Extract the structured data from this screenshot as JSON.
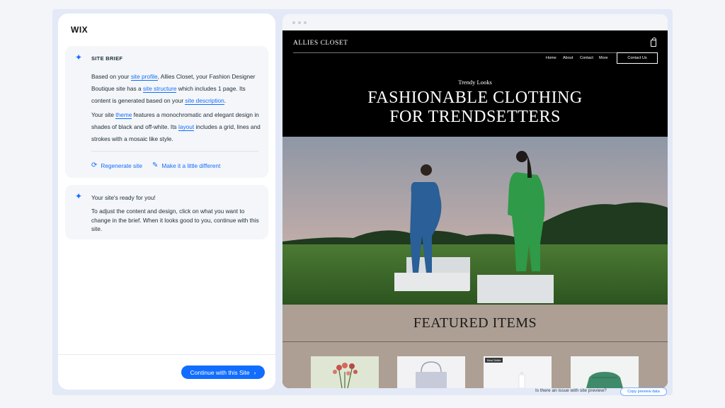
{
  "app": {
    "logo": "WIX"
  },
  "brief": {
    "title": "SITE BRIEF",
    "p1": {
      "t1": "Based on your ",
      "l1": "site profile",
      "t2": ", Allies Closet, your Fashion Designer Boutique site has a ",
      "l2": "site structure",
      "t3": " which includes 1 page. Its content is generated based on your ",
      "l3": "site description",
      "t4": "."
    },
    "p2": {
      "t1": "Your site ",
      "l1": "theme",
      "t2": " features a monochromatic and elegant design in shades of black and off-white. Its ",
      "l2": "layout",
      "t3": " includes a grid, lines and strokes with a mosaic like style."
    },
    "actions": {
      "regenerate": "Regenerate site",
      "different": "Make it a little different"
    }
  },
  "ready": {
    "title": "Your site's ready for you!",
    "text": "To adjust the content and design, click on what you want to change in the brief. When it looks good to you, continue with this site."
  },
  "footer": {
    "continue_label": "Continue with this Site",
    "continue_arrow": "›"
  },
  "preview": {
    "site_name": "ALLIES CLOSET",
    "nav": [
      "Home",
      "About",
      "Contact",
      "More"
    ],
    "contact_button": "Contact Us",
    "hero_subtitle": "Trendy Looks",
    "hero_title_line1": "FASHIONABLE CLOTHING",
    "hero_title_line2": "FOR TRENDSETTERS",
    "featured_title": "FEATURED ITEMS",
    "product_badge": "Best Seller"
  },
  "bottom": {
    "issue_text": "Is there an issue with site preview?",
    "copy_button": "Copy preview data"
  },
  "colors": {
    "accent": "#116dff",
    "site_bg": "#000000",
    "featured_bg": "#ad9f93"
  },
  "icons": {
    "sparkle": "sparkle-icon",
    "regenerate": "refresh-icon",
    "edit": "pencil-icon",
    "cart": "shopping-bag-icon"
  }
}
